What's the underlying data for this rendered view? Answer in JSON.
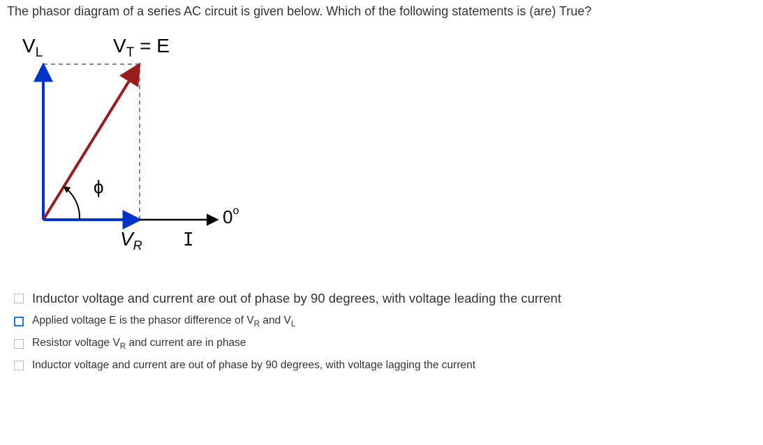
{
  "question": "The phasor diagram of a series AC circuit is given below. Which of the following statements is (are) True?",
  "diagram": {
    "label_VL": "V",
    "label_VL_sub": "L",
    "label_VT": "V",
    "label_VT_sub": "T",
    "label_eq": " = E",
    "label_phi": "ϕ",
    "label_VR": "V",
    "label_VR_sub": "R",
    "label_I": "I",
    "label_zero": "0",
    "label_zero_sup": "o"
  },
  "options": [
    {
      "text_parts": [
        "Inductor voltage and current are out of phase by 90 degrees, with voltage leading the current"
      ],
      "large": true,
      "checked_style": false
    },
    {
      "text_parts": [
        "Applied voltage E is the phasor difference of  V",
        {
          "sub": "R"
        },
        " and  V",
        {
          "sub": "L"
        }
      ],
      "large": false,
      "checked_style": true
    },
    {
      "text_parts": [
        "Resistor voltage V",
        {
          "sub": "R"
        },
        " and current are in phase"
      ],
      "large": false,
      "checked_style": false
    },
    {
      "text_parts": [
        "Inductor voltage and current are out of phase by 90 degrees, with voltage lagging the current"
      ],
      "large": false,
      "checked_style": false
    }
  ]
}
